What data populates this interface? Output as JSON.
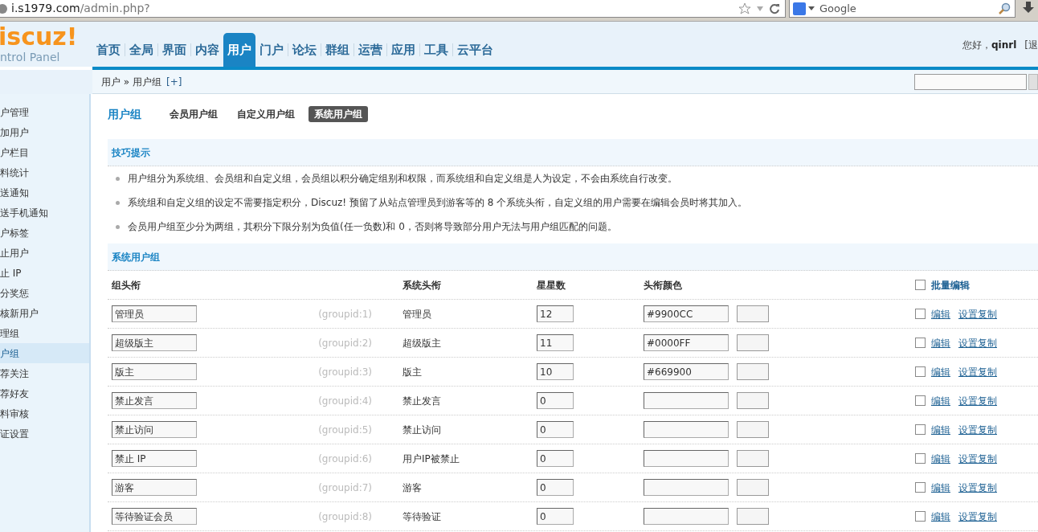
{
  "browser": {
    "url_host": "i.s1979.com",
    "url_path": "/admin.php?",
    "search_placeholder": "Google"
  },
  "header": {
    "logo": "iscuz!",
    "logo_subtitle": "ntrol Panel",
    "greeting": "您好，",
    "username": "qinrl",
    "logout": "[退",
    "nav": [
      {
        "label": "首页",
        "selected": false
      },
      {
        "label": "全局",
        "selected": false
      },
      {
        "label": "界面",
        "selected": false
      },
      {
        "label": "内容",
        "selected": false
      },
      {
        "label": "用户",
        "selected": true
      },
      {
        "label": "门户",
        "selected": false
      },
      {
        "label": "论坛",
        "selected": false
      },
      {
        "label": "群组",
        "selected": false
      },
      {
        "label": "运营",
        "selected": false
      },
      {
        "label": "应用",
        "selected": false
      },
      {
        "label": "工具",
        "selected": false
      },
      {
        "label": "云平台",
        "selected": false
      }
    ]
  },
  "breadcrumb": {
    "text": "用户 » 用户组",
    "add_link": "[+]"
  },
  "sidebar": {
    "items": [
      {
        "label": "户管理",
        "selected": false
      },
      {
        "label": "加用户",
        "selected": false
      },
      {
        "label": "户栏目",
        "selected": false
      },
      {
        "label": "料统计",
        "selected": false
      },
      {
        "label": "送通知",
        "selected": false
      },
      {
        "label": "送手机通知",
        "selected": false
      },
      {
        "label": "户标签",
        "selected": false
      },
      {
        "label": "止用户",
        "selected": false
      },
      {
        "label": "止 IP",
        "selected": false
      },
      {
        "label": "分奖惩",
        "selected": false
      },
      {
        "label": "核新用户",
        "selected": false
      },
      {
        "label": "理组",
        "selected": false
      },
      {
        "label": "户组",
        "selected": true
      },
      {
        "label": "荐关注",
        "selected": false
      },
      {
        "label": "荐好友",
        "selected": false
      },
      {
        "label": "料审核",
        "selected": false
      },
      {
        "label": "证设置",
        "selected": false
      }
    ]
  },
  "page": {
    "title": "用户组",
    "tabs": [
      {
        "label": "会员用户组",
        "selected": false
      },
      {
        "label": "自定义用户组",
        "selected": false
      },
      {
        "label": "系统用户组",
        "selected": true
      }
    ]
  },
  "tips": {
    "title": "技巧提示",
    "items": [
      "用户组分为系统组、会员组和自定义组，会员组以积分确定组别和权限，而系统组和自定义组是人为设定，不会由系统自行改变。",
      "系统组和自定义组的设定不需要指定积分，Discuz! 预留了从站点管理员到游客等的 8 个系统头衔，自定义组的用户需要在编辑会员时将其加入。",
      "会员用户组至少分为两组，其积分下限分别为负值(任一负数)和 0，否则将导致部分用户无法与用户组匹配的问题。"
    ]
  },
  "table": {
    "title": "系统用户组",
    "columns": [
      "组头衔",
      "系统头衔",
      "星星数",
      "头衔颜色"
    ],
    "batch_edit": {
      "label": "批量编辑",
      "checked": false
    },
    "rows": [
      {
        "title": "管理员",
        "groupid": "(groupid:1)",
        "system_title": "管理员",
        "star_count": "12",
        "color_code": "#9900CC",
        "checked": false,
        "actions": [
          "编辑",
          "设置复制"
        ]
      },
      {
        "title": "超级版主",
        "groupid": "(groupid:2)",
        "system_title": "超级版主",
        "star_count": "11",
        "color_code": "#0000FF",
        "checked": false,
        "actions": [
          "编辑",
          "设置复制"
        ]
      },
      {
        "title": "版主",
        "groupid": "(groupid:3)",
        "system_title": "版主",
        "star_count": "10",
        "color_code": "#669900",
        "checked": false,
        "actions": [
          "编辑",
          "设置复制"
        ]
      },
      {
        "title": "禁止发言",
        "groupid": "(groupid:4)",
        "system_title": "禁止发言",
        "star_count": "0",
        "checked": false,
        "actions": [
          "编辑",
          "设置复制"
        ]
      },
      {
        "title": "禁止访问",
        "groupid": "(groupid:5)",
        "system_title": "禁止访问",
        "star_count": "0",
        "checked": false,
        "actions": [
          "编辑",
          "设置复制"
        ]
      },
      {
        "title": "禁止 IP",
        "groupid": "(groupid:6)",
        "system_title": "用户IP被禁止",
        "star_count": "0",
        "checked": false,
        "actions": [
          "编辑",
          "设置复制"
        ]
      },
      {
        "title": "游客",
        "groupid": "(groupid:7)",
        "system_title": "游客",
        "star_count": "0",
        "checked": false,
        "actions": [
          "编辑",
          "设置复制"
        ]
      },
      {
        "title": "等待验证会员",
        "groupid": "(groupid:8)",
        "system_title": "等待验证",
        "star_count": "0",
        "checked": false,
        "actions": [
          "编辑",
          "设置复制"
        ]
      }
    ]
  }
}
